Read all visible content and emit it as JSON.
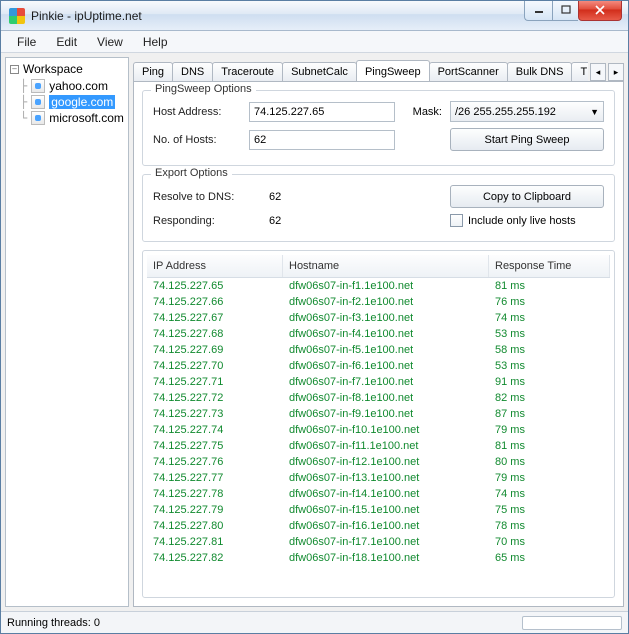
{
  "window": {
    "title": "Pinkie - ipUptime.net"
  },
  "menu": {
    "file": "File",
    "edit": "Edit",
    "view": "View",
    "help": "Help"
  },
  "sidebar": {
    "root_label": "Workspace",
    "items": [
      {
        "label": "yahoo.com",
        "selected": false
      },
      {
        "label": "google.com",
        "selected": true
      },
      {
        "label": "microsoft.com",
        "selected": false
      }
    ]
  },
  "tabs": {
    "items": [
      "Ping",
      "DNS",
      "Traceroute",
      "SubnetCalc",
      "PingSweep",
      "PortScanner",
      "Bulk DNS",
      "TFTP S"
    ],
    "active_index": 4
  },
  "pingsweep": {
    "legend": "PingSweep Options",
    "host_label": "Host Address:",
    "host_value": "74.125.227.65",
    "hosts_label": "No. of Hosts:",
    "hosts_value": "62",
    "mask_label": "Mask:",
    "mask_value": "/26   255.255.255.192",
    "start_button": "Start Ping Sweep"
  },
  "export": {
    "legend": "Export Options",
    "resolve_label": "Resolve to DNS:",
    "resolve_value": "62",
    "responding_label": "Responding:",
    "responding_value": "62",
    "copy_button": "Copy to Clipboard",
    "include_label": "Include only live hosts"
  },
  "columns": {
    "ip": "IP Address",
    "hostname": "Hostname",
    "rt": "Response Time"
  },
  "results": [
    {
      "ip": "74.125.227.65",
      "hn": "dfw06s07-in-f1.1e100.net",
      "rt": "81 ms"
    },
    {
      "ip": "74.125.227.66",
      "hn": "dfw06s07-in-f2.1e100.net",
      "rt": "76 ms"
    },
    {
      "ip": "74.125.227.67",
      "hn": "dfw06s07-in-f3.1e100.net",
      "rt": "74 ms"
    },
    {
      "ip": "74.125.227.68",
      "hn": "dfw06s07-in-f4.1e100.net",
      "rt": "53 ms"
    },
    {
      "ip": "74.125.227.69",
      "hn": "dfw06s07-in-f5.1e100.net",
      "rt": "58 ms"
    },
    {
      "ip": "74.125.227.70",
      "hn": "dfw06s07-in-f6.1e100.net",
      "rt": "53 ms"
    },
    {
      "ip": "74.125.227.71",
      "hn": "dfw06s07-in-f7.1e100.net",
      "rt": "91 ms"
    },
    {
      "ip": "74.125.227.72",
      "hn": "dfw06s07-in-f8.1e100.net",
      "rt": "82 ms"
    },
    {
      "ip": "74.125.227.73",
      "hn": "dfw06s07-in-f9.1e100.net",
      "rt": "87 ms"
    },
    {
      "ip": "74.125.227.74",
      "hn": "dfw06s07-in-f10.1e100.net",
      "rt": "79 ms"
    },
    {
      "ip": "74.125.227.75",
      "hn": "dfw06s07-in-f11.1e100.net",
      "rt": "81 ms"
    },
    {
      "ip": "74.125.227.76",
      "hn": "dfw06s07-in-f12.1e100.net",
      "rt": "80 ms"
    },
    {
      "ip": "74.125.227.77",
      "hn": "dfw06s07-in-f13.1e100.net",
      "rt": "79 ms"
    },
    {
      "ip": "74.125.227.78",
      "hn": "dfw06s07-in-f14.1e100.net",
      "rt": "74 ms"
    },
    {
      "ip": "74.125.227.79",
      "hn": "dfw06s07-in-f15.1e100.net",
      "rt": "75 ms"
    },
    {
      "ip": "74.125.227.80",
      "hn": "dfw06s07-in-f16.1e100.net",
      "rt": "78 ms"
    },
    {
      "ip": "74.125.227.81",
      "hn": "dfw06s07-in-f17.1e100.net",
      "rt": "70 ms"
    },
    {
      "ip": "74.125.227.82",
      "hn": "dfw06s07-in-f18.1e100.net",
      "rt": "65 ms"
    }
  ],
  "status": {
    "threads": "Running threads: 0"
  }
}
